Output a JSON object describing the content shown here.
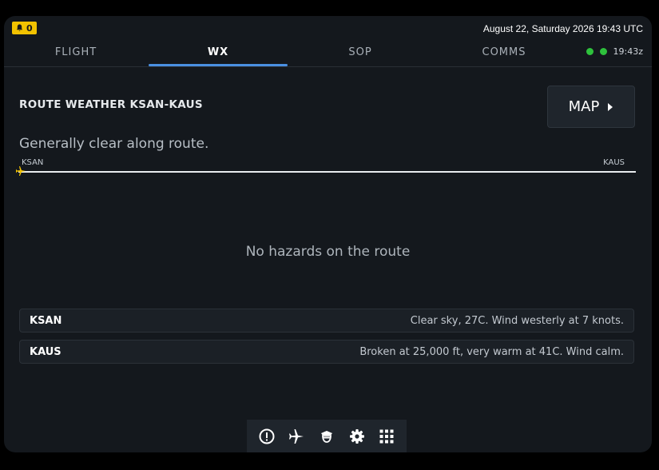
{
  "status_bar": {
    "alert_count": "0",
    "datetime": "August 22, Saturday 2026 19:43 UTC",
    "zulu_time": "19:43z"
  },
  "tabs": [
    {
      "label": "FLIGHT",
      "active": false
    },
    {
      "label": "WX",
      "active": true
    },
    {
      "label": "SOP",
      "active": false
    },
    {
      "label": "COMMS",
      "active": false
    }
  ],
  "route_weather": {
    "title": "ROUTE WEATHER KSAN-KAUS",
    "map_button_label": "MAP",
    "summary": "Generally clear along route.",
    "origin": "KSAN",
    "destination": "KAUS",
    "no_hazards": "No hazards on the route"
  },
  "stations": [
    {
      "id": "KSAN",
      "weather": "Clear sky, 27C. Wind westerly at 7 knots."
    },
    {
      "id": "KAUS",
      "weather": "Broken at 25,000 ft, very warm at 41C. Wind calm."
    }
  ],
  "dock": {
    "icons": [
      "info-icon",
      "airplane-icon",
      "pilot-icon",
      "gear-icon",
      "grid-icon"
    ]
  },
  "colors": {
    "accent": "#4a90e2",
    "alert": "#f2c200",
    "status_ok": "#2ec13c",
    "background": "#14181d"
  }
}
